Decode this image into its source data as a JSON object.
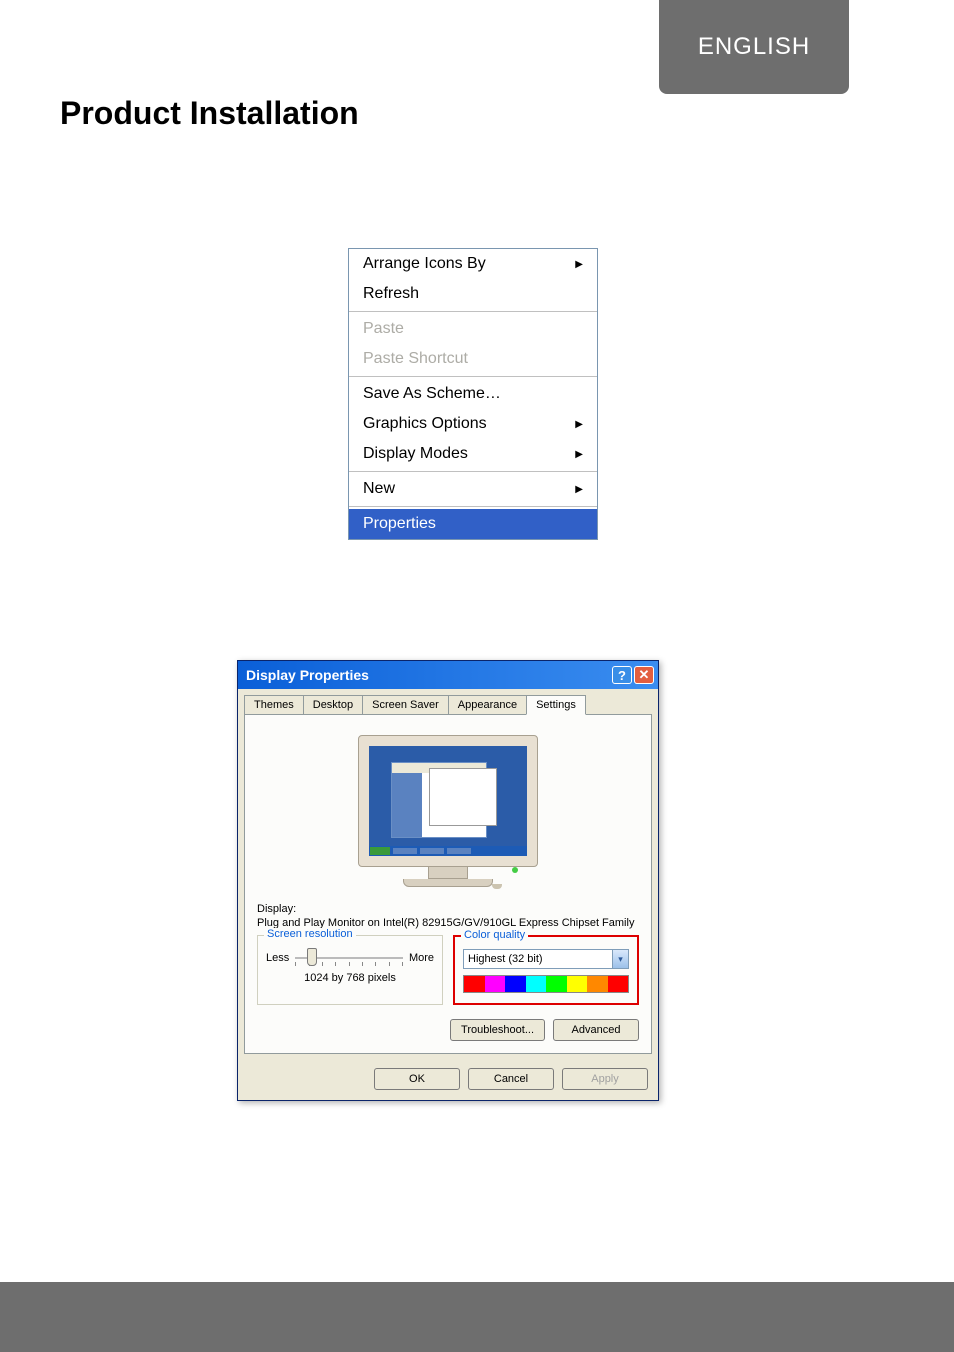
{
  "lang": "ENGLISH",
  "title": "Product Installation",
  "contextMenu": {
    "arrange": "Arrange Icons By",
    "refresh": "Refresh",
    "paste": "Paste",
    "pasteShortcut": "Paste Shortcut",
    "saveScheme": "Save As Scheme…",
    "graphicsOptions": "Graphics Options",
    "displayModes": "Display Modes",
    "newItem": "New",
    "properties": "Properties"
  },
  "dialog": {
    "title": "Display Properties",
    "tabs": {
      "themes": "Themes",
      "desktop": "Desktop",
      "screensaver": "Screen Saver",
      "appearance": "Appearance",
      "settings": "Settings"
    },
    "displayLabel": "Display:",
    "displayText": "Plug and Play Monitor on Intel(R) 82915G/GV/910GL Express Chipset Family",
    "screenRes": {
      "legend": "Screen resolution",
      "less": "Less",
      "more": "More",
      "value": "1024 by 768 pixels"
    },
    "colorQuality": {
      "legend": "Color quality",
      "value": "Highest (32 bit)"
    },
    "buttons": {
      "troubleshoot": "Troubleshoot...",
      "advanced": "Advanced",
      "ok": "OK",
      "cancel": "Cancel",
      "apply": "Apply"
    }
  }
}
